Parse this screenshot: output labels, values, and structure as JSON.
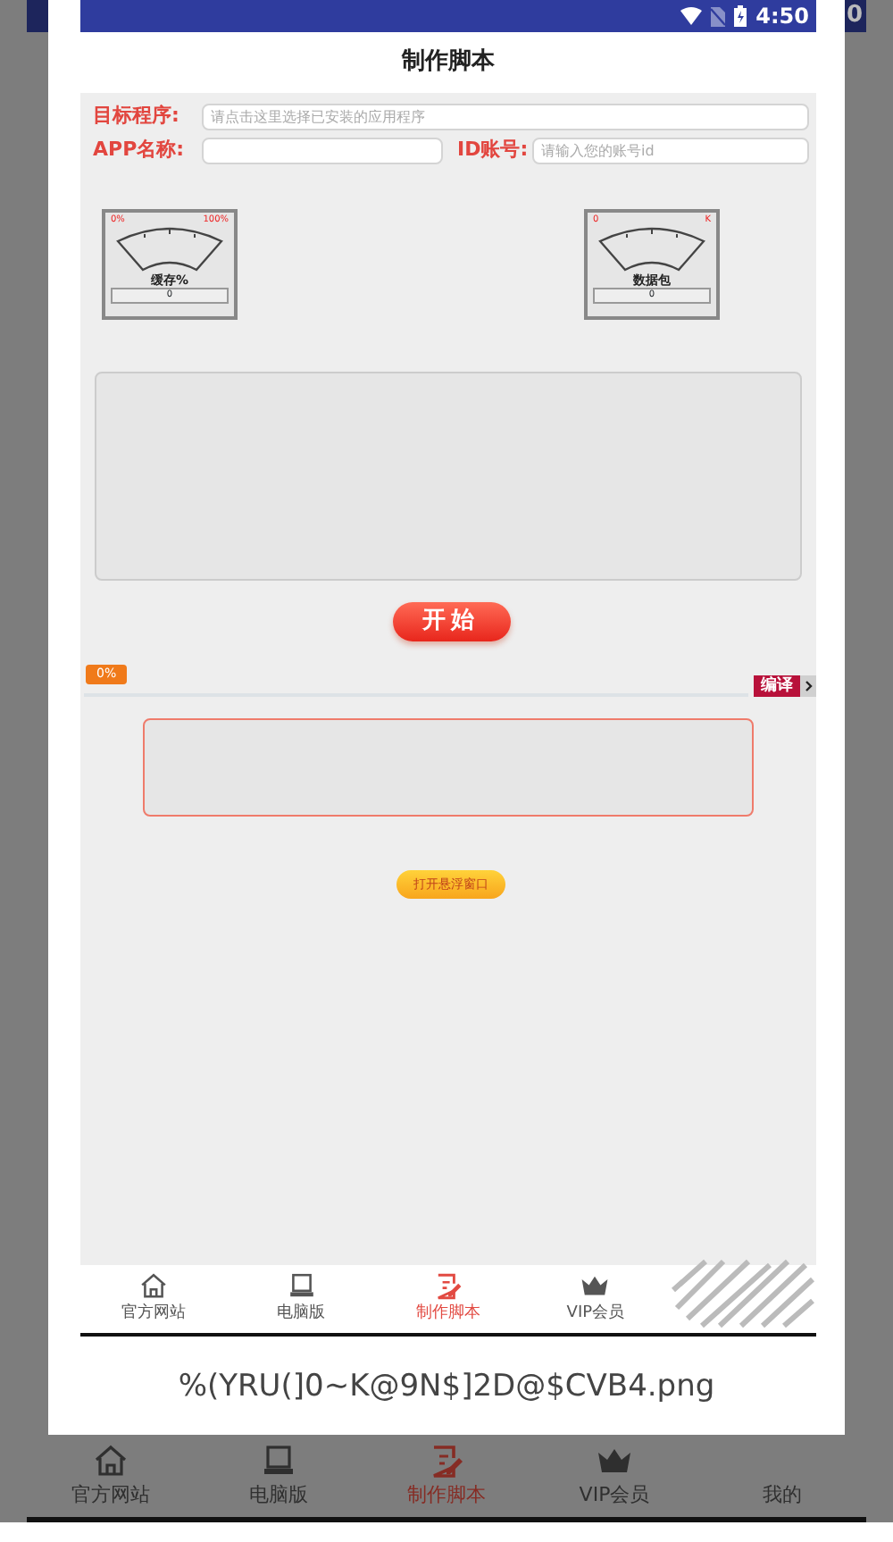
{
  "background": {
    "status_text": "0",
    "tabs": [
      {
        "label": "官方网站",
        "kind": "home",
        "selected": false
      },
      {
        "label": "电脑版",
        "kind": "monitor",
        "selected": false
      },
      {
        "label": "制作脚本",
        "kind": "edit",
        "selected": true
      },
      {
        "label": "VIP会员",
        "kind": "crown",
        "selected": false
      },
      {
        "label": "我的",
        "selected": false
      }
    ]
  },
  "dialog": {
    "screen": {
      "status_bar": {
        "time": "4:50"
      },
      "title": "制作脚本",
      "form": {
        "target": {
          "label": "目标程序:",
          "placeholder": "请点击这里选择已安装的应用程序"
        },
        "app_name": {
          "label": "APP名称:"
        },
        "account": {
          "label": "ID账号:",
          "placeholder": "请输入您的账号id"
        }
      },
      "gauges": [
        {
          "min": "0%",
          "max": "100%",
          "caption": "缓存%",
          "value": "0"
        },
        {
          "min": "0",
          "max": "K",
          "caption": "数据包",
          "value": "0"
        }
      ],
      "start_button": "开始",
      "progress": {
        "label": "0%"
      },
      "compile_button": "编译",
      "float_button": "打开悬浮窗口",
      "tabs": [
        {
          "label": "官方网站",
          "kind": "home",
          "selected": false
        },
        {
          "label": "电脑版",
          "kind": "monitor",
          "selected": false
        },
        {
          "label": "制作脚本",
          "kind": "edit",
          "selected": true
        },
        {
          "label": "VIP会员",
          "kind": "crown",
          "selected": false
        }
      ]
    },
    "filename": "%(YRU(]0~K@9N$]2D@$CVB4.png"
  }
}
